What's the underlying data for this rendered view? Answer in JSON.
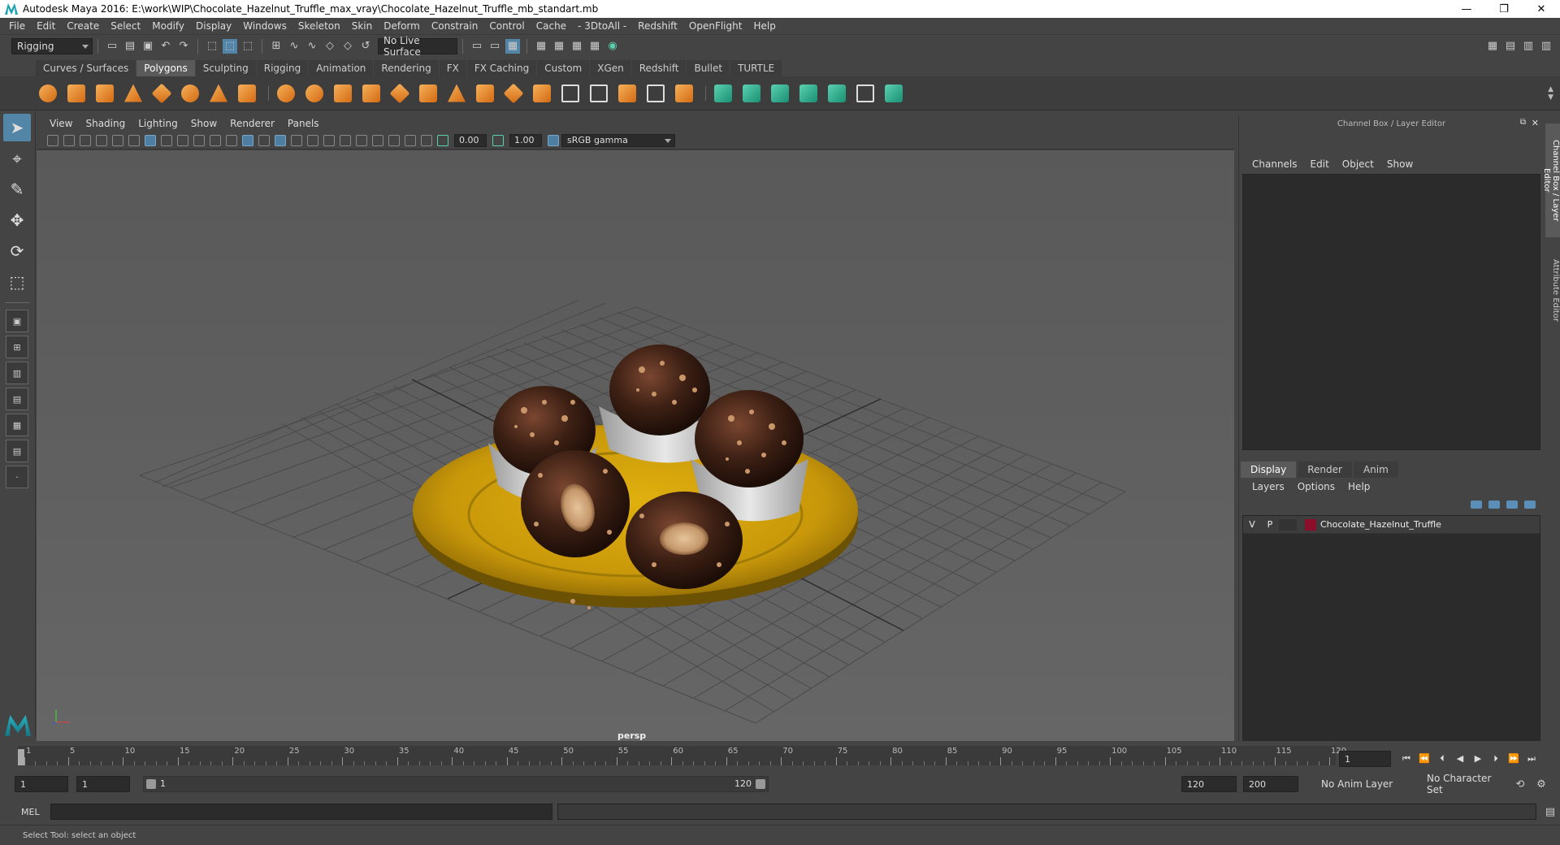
{
  "window": {
    "title": "Autodesk Maya 2016: E:\\work\\WIP\\Chocolate_Hazelnut_Truffle_max_vray\\Chocolate_Hazelnut_Truffle_mb_standart.mb",
    "minimize": "—",
    "maximize": "❐",
    "close": "✕"
  },
  "menus": [
    "File",
    "Edit",
    "Create",
    "Select",
    "Modify",
    "Display",
    "Windows",
    "Skeleton",
    "Skin",
    "Deform",
    "Constrain",
    "Control",
    "Cache",
    "- 3DtoAll -",
    "Redshift",
    "OpenFlight",
    "Help"
  ],
  "status": {
    "mode": "Rigging",
    "live_surface": "No Live Surface"
  },
  "shelf_tabs": [
    {
      "label": "Curves / Surfaces",
      "active": false
    },
    {
      "label": "Polygons",
      "active": true
    },
    {
      "label": "Sculpting",
      "active": false
    },
    {
      "label": "Rigging",
      "active": false
    },
    {
      "label": "Animation",
      "active": false
    },
    {
      "label": "Rendering",
      "active": false
    },
    {
      "label": "FX",
      "active": false
    },
    {
      "label": "FX Caching",
      "active": false
    },
    {
      "label": "Custom",
      "active": false
    },
    {
      "label": "XGen",
      "active": false
    },
    {
      "label": "Redshift",
      "active": false
    },
    {
      "label": "Bullet",
      "active": false
    },
    {
      "label": "TURTLE",
      "active": false
    }
  ],
  "viewport": {
    "menus": [
      "View",
      "Shading",
      "Lighting",
      "Show",
      "Renderer",
      "Panels"
    ],
    "exposure": "0.00",
    "gamma": "1.00",
    "colorspace": "sRGB gamma",
    "camera": "persp"
  },
  "channel_box": {
    "title": "Channel Box / Layer Editor",
    "menus": [
      "Channels",
      "Edit",
      "Object",
      "Show"
    ]
  },
  "layer_editor": {
    "tabs": [
      {
        "label": "Display",
        "active": true
      },
      {
        "label": "Render",
        "active": false
      },
      {
        "label": "Anim",
        "active": false
      }
    ],
    "menus": [
      "Layers",
      "Options",
      "Help"
    ],
    "layers": [
      {
        "v": "V",
        "p": "P",
        "name": "Chocolate_Hazelnut_Truffle",
        "color": "#8a0e2a"
      }
    ]
  },
  "side_tabs": [
    "Channel Box / Layer Editor",
    "Attribute Editor"
  ],
  "timeline": {
    "labels": [
      "1",
      "5",
      "10",
      "15",
      "20",
      "25",
      "30",
      "35",
      "40",
      "45",
      "50",
      "55",
      "60",
      "65",
      "70",
      "75",
      "80",
      "85",
      "90",
      "95",
      "100",
      "105",
      "110",
      "115",
      "120"
    ],
    "current_frame": "1"
  },
  "range": {
    "start": "1",
    "playback_start": "1",
    "slider_start": "1",
    "slider_end": "120",
    "playback_end": "120",
    "end": "200",
    "anim_layer": "No Anim Layer",
    "character_set": "No Character Set"
  },
  "command_line": {
    "label": "MEL"
  },
  "help_line": "Select Tool: select an object"
}
